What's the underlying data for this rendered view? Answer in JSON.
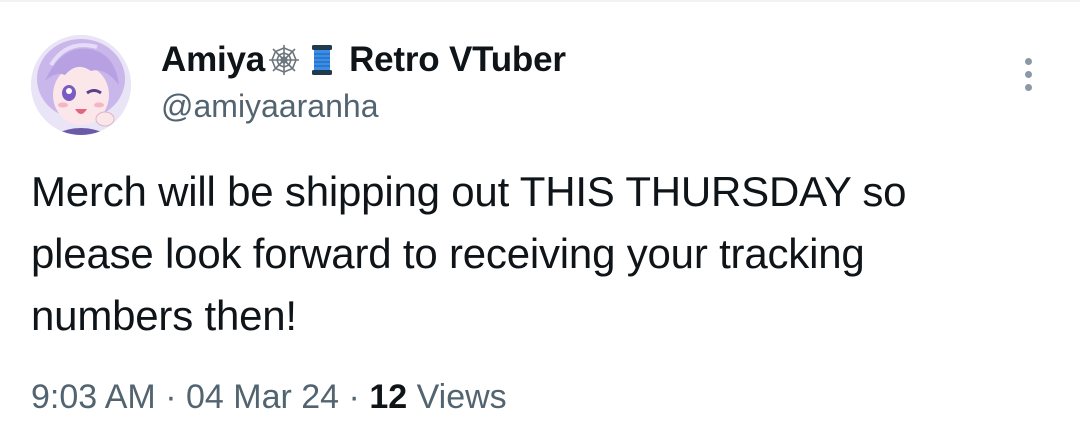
{
  "tweet": {
    "author": {
      "display_name": "Amiya",
      "name_suffix": "Retro VTuber",
      "handle": "@amiyaaranha",
      "emojis": [
        "spider-web-icon",
        "spool-of-thread-icon"
      ],
      "avatar": "avatar-image"
    },
    "text_lines": [
      "Merch will be shipping out THIS THURSDAY so",
      "please look forward to receiving your tracking",
      "numbers then!"
    ],
    "meta": {
      "time": "9:03 AM",
      "separator": "·",
      "date": "04 Mar 24",
      "views_count": "12",
      "views_label": "Views"
    },
    "more_icon": "more-options-icon"
  },
  "colors": {
    "text_primary": "#0f1419",
    "text_secondary": "#536471",
    "icon_gray": "#8b98a5",
    "divider": "#eff3f4",
    "spool_blue": "#3b8ee8"
  }
}
